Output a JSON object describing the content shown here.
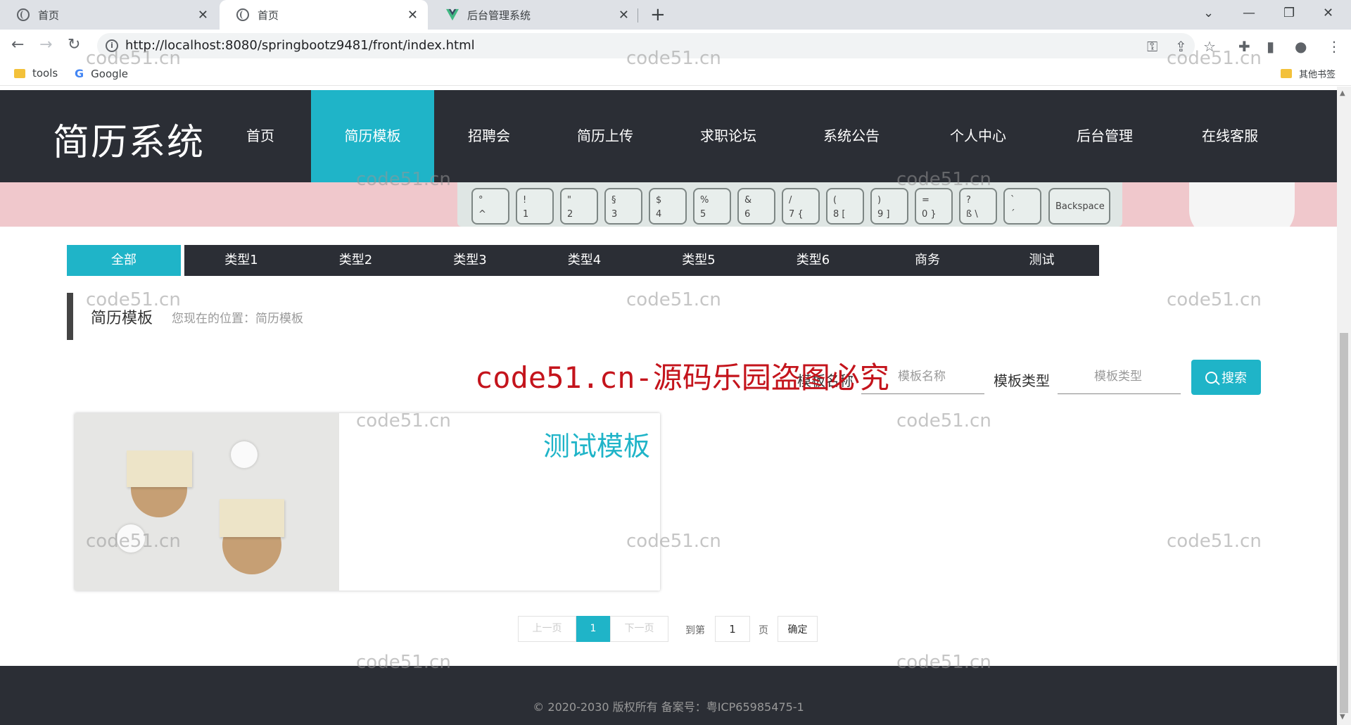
{
  "browser": {
    "tabs": [
      {
        "title": "首页"
      },
      {
        "title": "首页"
      },
      {
        "title": "后台管理系统"
      }
    ],
    "url": "http://localhost:8080/springbootz9481/front/index.html",
    "bookmarks": [
      {
        "label": "tools"
      },
      {
        "label": "Google"
      }
    ],
    "other_bookmarks": "其他书签"
  },
  "site": {
    "logo": "简历系统",
    "nav": [
      {
        "label": "首页"
      },
      {
        "label": "简历模板"
      },
      {
        "label": "招聘会"
      },
      {
        "label": "简历上传"
      },
      {
        "label": "求职论坛"
      },
      {
        "label": "系统公告"
      },
      {
        "label": "个人中心"
      },
      {
        "label": "后台管理"
      },
      {
        "label": "在线客服"
      }
    ],
    "active_nav": "简历模板"
  },
  "banner": {
    "keys": [
      {
        "top": "°",
        "bottom": "^"
      },
      {
        "top": "!",
        "bottom": "1"
      },
      {
        "top": "\"",
        "bottom": "2"
      },
      {
        "top": "§",
        "bottom": "3"
      },
      {
        "top": "$",
        "bottom": "4"
      },
      {
        "top": "%",
        "bottom": "5"
      },
      {
        "top": "&",
        "bottom": "6"
      },
      {
        "top": "/",
        "bottom": "7 {"
      },
      {
        "top": "(",
        "bottom": "8 ["
      },
      {
        "top": ")",
        "bottom": "9 ]"
      },
      {
        "top": "=",
        "bottom": "0 }"
      },
      {
        "top": "?",
        "bottom": "ß \\"
      },
      {
        "top": "`",
        "bottom": "´"
      }
    ],
    "backspace": "Backspace"
  },
  "categories": [
    {
      "label": "全部"
    },
    {
      "label": "类型1"
    },
    {
      "label": "类型2"
    },
    {
      "label": "类型3"
    },
    {
      "label": "类型4"
    },
    {
      "label": "类型5"
    },
    {
      "label": "类型6"
    },
    {
      "label": "商务"
    },
    {
      "label": "测试"
    }
  ],
  "breadcrumb": {
    "title": "简历模板",
    "location": "您现在的位置：简历模板"
  },
  "search": {
    "name_label": "模板名称",
    "name_placeholder": "模板名称",
    "type_label": "模板类型",
    "type_placeholder": "模板类型",
    "button": "搜索"
  },
  "cards": [
    {
      "title": "测试模板"
    }
  ],
  "pagination": {
    "prev": "上一页",
    "current": "1",
    "next": "下一页",
    "goto_label": "到第",
    "goto_value": "1",
    "page_unit": "页",
    "confirm": "确定"
  },
  "footer": {
    "copyright": "© 2020-2030 版权所有 备案号：粤ICP65985475-1"
  },
  "watermark": {
    "text": "code51.cn",
    "red_text": "code51.cn-源码乐园盗图必究"
  },
  "colors": {
    "accent": "#1fb4c8",
    "header_bg": "#2b2e35",
    "watermark_red": "#c4141c"
  }
}
